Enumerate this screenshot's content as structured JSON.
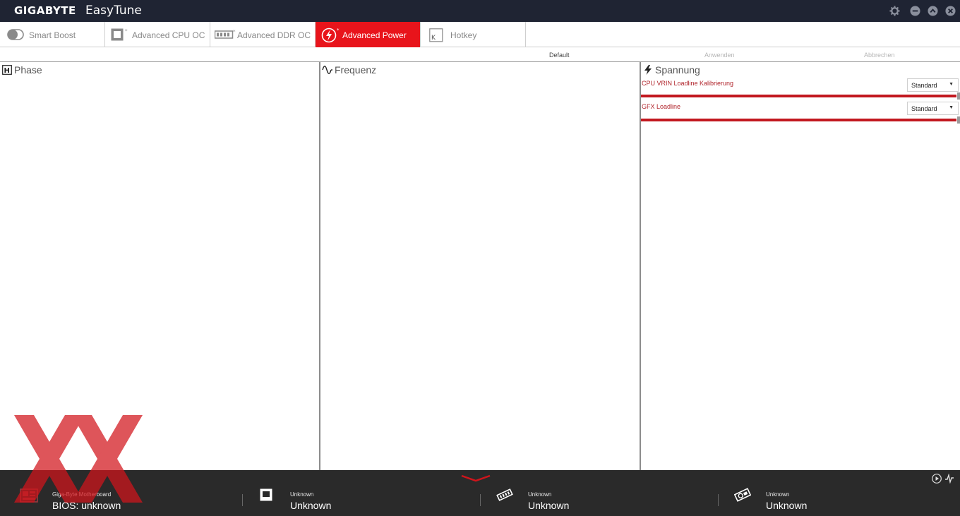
{
  "titlebar": {
    "brand": "GIGABYTE",
    "app_name": "EasyTune"
  },
  "tabs": [
    {
      "label": "Smart Boost",
      "icon": "toggle-icon",
      "active": false
    },
    {
      "label": "Advanced CPU OC",
      "icon": "cpu-icon",
      "active": false
    },
    {
      "label": "Advanced DDR OC",
      "icon": "memory-icon",
      "active": false
    },
    {
      "label": "Advanced Power",
      "icon": "power-icon",
      "active": true
    },
    {
      "label": "Hotkey",
      "icon": "keyboard-key-icon",
      "key_glyph": "K",
      "active": false
    }
  ],
  "actions": {
    "default": "Default",
    "apply": "Anwenden",
    "cancel": "Abbrechen"
  },
  "panels": {
    "phase": {
      "title": "Phase",
      "icon_glyph": "H"
    },
    "frequency": {
      "title": "Frequenz"
    },
    "voltage": {
      "title": "Spannung",
      "settings": [
        {
          "label": "CPU VRIN Loadline Kalibrierung",
          "value": "Standard"
        },
        {
          "label": "GFX Loadline",
          "value": "Standard"
        }
      ]
    }
  },
  "status": [
    {
      "small": "Giga-Byte Motherboard",
      "big": "BIOS: unknown",
      "icon": "motherboard-icon"
    },
    {
      "small": "Unknown",
      "big": "Unknown",
      "icon": "cpu-icon"
    },
    {
      "small": "Unknown",
      "big": "Unknown",
      "icon": "memory-icon"
    },
    {
      "small": "Unknown",
      "big": "Unknown",
      "icon": "graphics-card-icon"
    }
  ],
  "colors": {
    "accent": "#e8141b",
    "titlebar": "#1f2433",
    "statusbar": "#2a2a2a",
    "setting_label": "#b0232a"
  }
}
